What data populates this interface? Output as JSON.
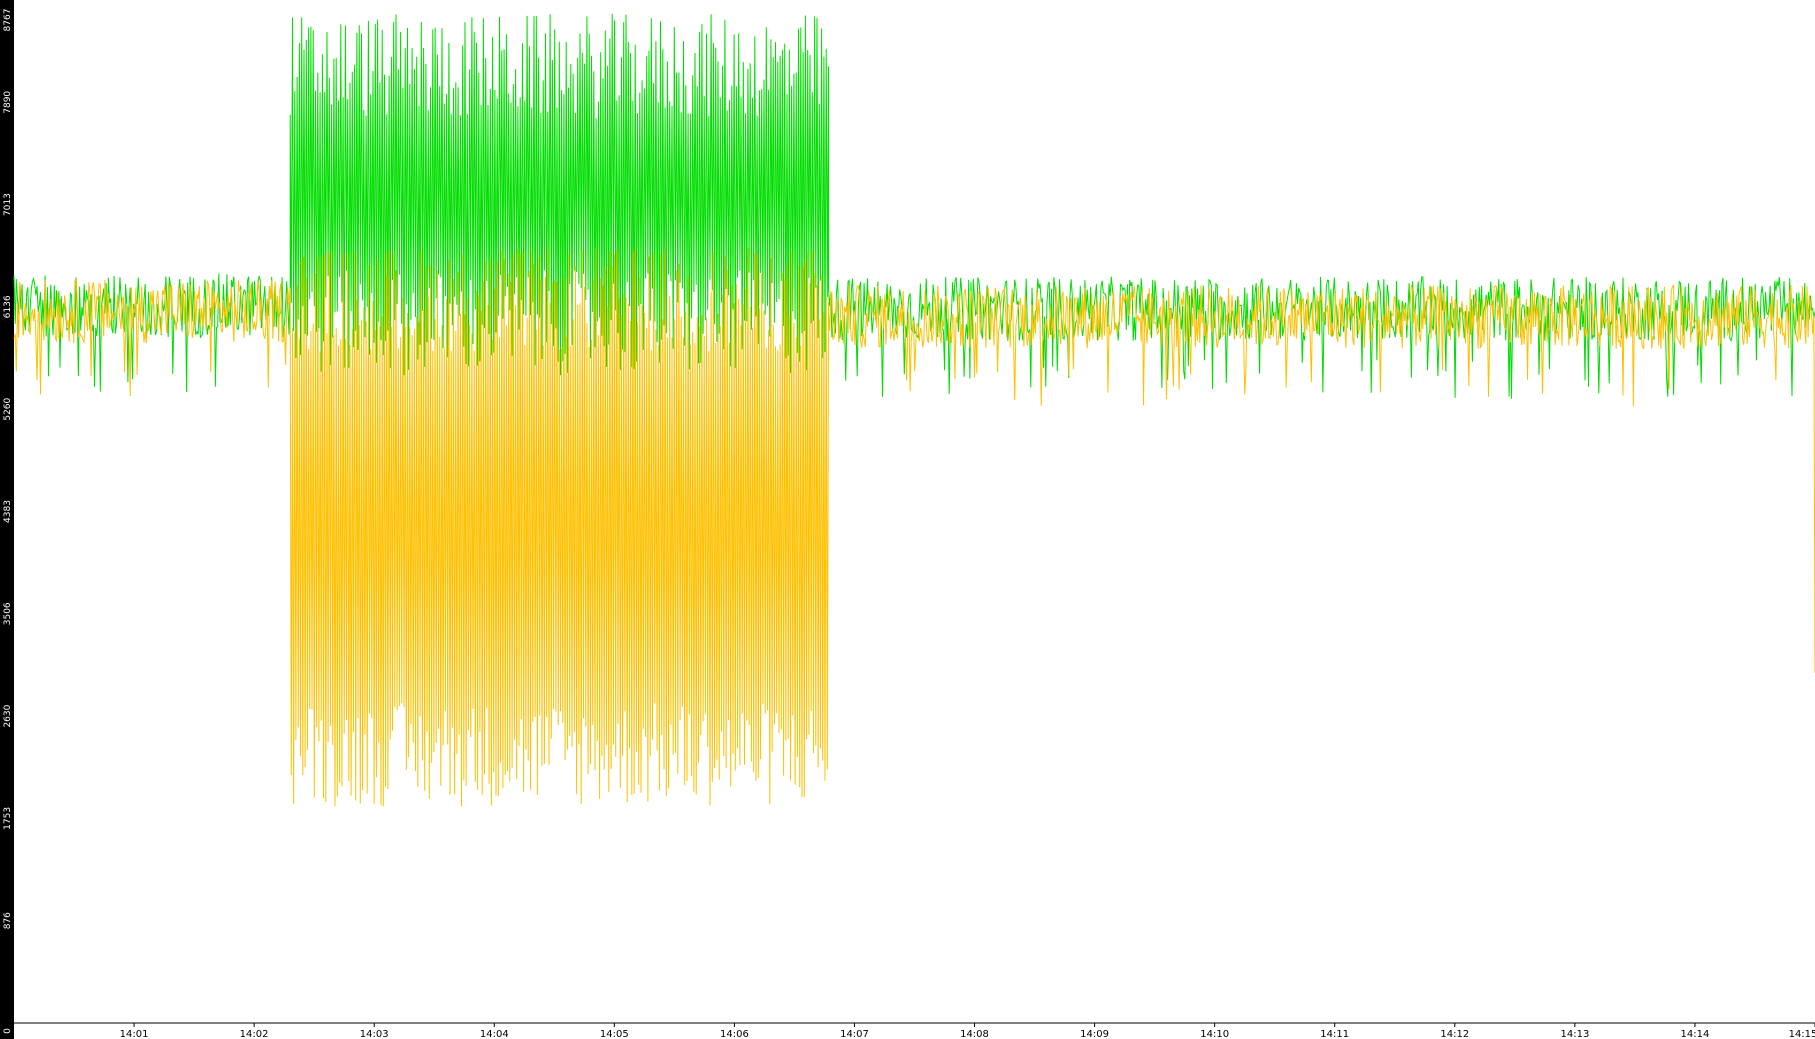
{
  "chart_data": {
    "type": "line",
    "title": "",
    "xlabel": "",
    "ylabel": "",
    "grid": false,
    "legend": "none",
    "ylim": [
      0,
      8767
    ],
    "yticks": [
      "0",
      "876",
      "1753",
      "2630",
      "3506",
      "4383",
      "5260",
      "6136",
      "7013",
      "7890",
      "8767"
    ],
    "xlim_minutes": [
      0.0,
      15.0
    ],
    "xticks": [
      "14:01",
      "14:02",
      "14:03",
      "14:04",
      "14:05",
      "14:06",
      "14:07",
      "14:08",
      "14:09",
      "14:10",
      "14:11",
      "14:12",
      "14:13",
      "14:14",
      "14:15"
    ],
    "colors": {
      "axis_strip": "#000000",
      "upper_series": "#00dd00",
      "lower_series": "#ffc000",
      "background": "#ffffff"
    },
    "series": [
      {
        "color": "#00dd00",
        "segments": [
          {
            "time_range": [
              "14:00:00",
              "14:02:18"
            ],
            "mean": 6150,
            "spread": 550,
            "min": 5250,
            "max": 6600
          },
          {
            "time_range": [
              "14:02:18",
              "14:06:47"
            ],
            "oscillating": true,
            "low_mean": 6000,
            "high_mean": 8200,
            "max": 8767
          },
          {
            "time_range": [
              "14:06:47",
              "14:15:00"
            ],
            "mean": 6120,
            "spread": 550,
            "min": 5000,
            "max": 6950
          }
        ]
      },
      {
        "color": "#ffc000",
        "segments": [
          {
            "time_range": [
              "14:00:00",
              "14:02:18"
            ],
            "mean": 6100,
            "spread": 550,
            "min": 5050,
            "max": 6750
          },
          {
            "time_range": [
              "14:02:18",
              "14:06:47"
            ],
            "oscillating": true,
            "low_mean": 2300,
            "high_mean": 6200,
            "min": 1700
          },
          {
            "time_range": [
              "14:06:47",
              "14:15:00"
            ],
            "mean": 6050,
            "spread": 550,
            "min": 5050,
            "max": 6700,
            "end_value": 3000
          }
        ]
      }
    ]
  }
}
